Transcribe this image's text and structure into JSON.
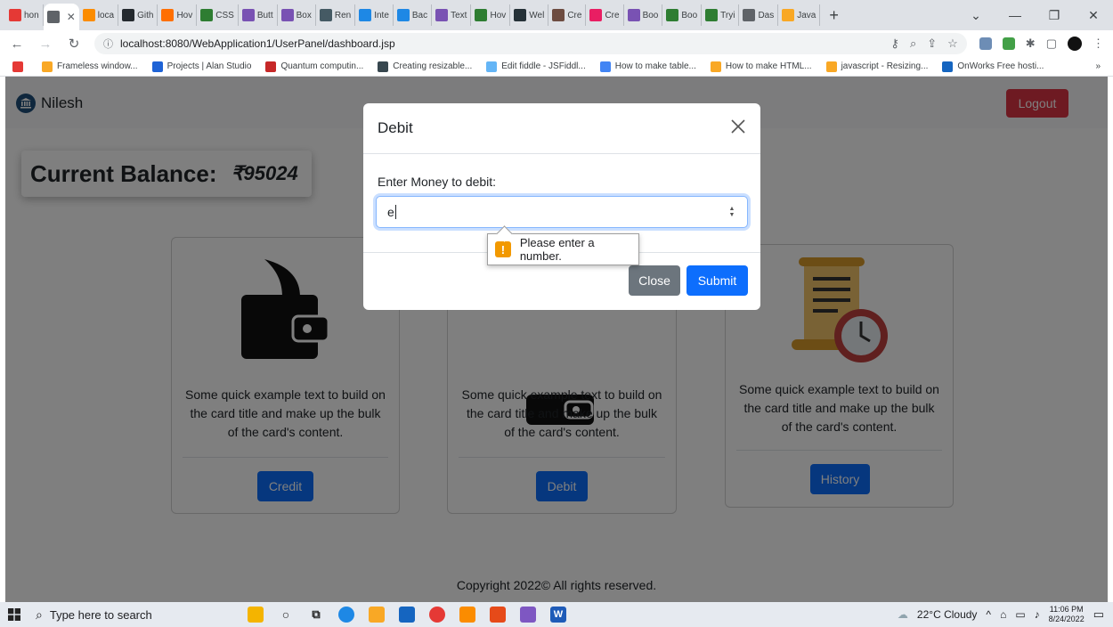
{
  "browser": {
    "tabs": [
      {
        "label": "hon",
        "icon": "youtube-icon",
        "color": "#e53935"
      },
      {
        "label": "",
        "icon": "globe-icon",
        "color": "#5f6368",
        "active": true
      },
      {
        "label": "loca",
        "icon": "xampp-icon",
        "color": "#fb8c00"
      },
      {
        "label": "Gith",
        "icon": "github-icon",
        "color": "#24292e"
      },
      {
        "label": "Hov",
        "icon": "blogger-icon",
        "color": "#ff6f00"
      },
      {
        "label": "CSS",
        "icon": "w-icon",
        "color": "#2e7d32"
      },
      {
        "label": "Butt",
        "icon": "bootstrap-icon",
        "color": "#7952b3"
      },
      {
        "label": "Box",
        "icon": "bootstrap-icon",
        "color": "#7952b3"
      },
      {
        "label": "Ren",
        "icon": "eye-icon",
        "color": "#455a64"
      },
      {
        "label": "Inte",
        "icon": "is-icon",
        "color": "#1e88e5"
      },
      {
        "label": "Bac",
        "icon": "is-icon",
        "color": "#1e88e5"
      },
      {
        "label": "Text",
        "icon": "bootstrap-icon",
        "color": "#7952b3"
      },
      {
        "label": "Hov",
        "icon": "w-icon",
        "color": "#2e7d32"
      },
      {
        "label": "Wel",
        "icon": "fiddle-icon",
        "color": "#263238"
      },
      {
        "label": "Cre",
        "icon": "image-icon",
        "color": "#6d4c41"
      },
      {
        "label": "Cre",
        "icon": "circle-icon",
        "color": "#e91e63"
      },
      {
        "label": "Boo",
        "icon": "bootstrap-icon",
        "color": "#7952b3"
      },
      {
        "label": "Boo",
        "icon": "w-icon",
        "color": "#2e7d32"
      },
      {
        "label": "Tryi",
        "icon": "w-icon",
        "color": "#2e7d32"
      },
      {
        "label": "Das",
        "icon": "globe-icon",
        "color": "#5f6368"
      },
      {
        "label": "Java",
        "icon": "java-icon",
        "color": "#f9a825"
      }
    ],
    "address": "localhost:8080/WebApplication1/UserPanel/dashboard.jsp",
    "bookmarks": [
      {
        "label": "",
        "color": "#e53935"
      },
      {
        "label": "Frameless window...",
        "color": "#f9a825"
      },
      {
        "label": "Projects | Alan Studio",
        "color": "#1e63d6"
      },
      {
        "label": "Quantum computin...",
        "color": "#c62828"
      },
      {
        "label": "Creating resizable...",
        "color": "#37474f"
      },
      {
        "label": "Edit fiddle - JSFiddl...",
        "color": "#64b5f6"
      },
      {
        "label": "How to make table...",
        "color": "#4285f4"
      },
      {
        "label": "How to make HTML...",
        "color": "#f9a825"
      },
      {
        "label": "javascript - Resizing...",
        "color": "#f9a825"
      },
      {
        "label": "OnWorks Free hosti...",
        "color": "#1565c0"
      }
    ]
  },
  "app": {
    "brand": "Nilesh",
    "logout": "Logout",
    "balance_label": "Current Balance:",
    "balance_amount": "₹95024",
    "cards": [
      {
        "text": "Some quick example text to build on the card title and make up the bulk of the card's content.",
        "button": "Credit",
        "icon": "wallet-credit-icon"
      },
      {
        "text": "Some quick example text to build on the card title and make up the bulk of the card's content.",
        "button": "Debit",
        "icon": "wallet-debit-icon"
      },
      {
        "text": "Some quick example text to build on the card title and make up the bulk of the card's content.",
        "button": "History",
        "icon": "history-scroll-icon"
      }
    ],
    "footer": "Copyright 2022© All rights reserved."
  },
  "modal": {
    "title": "Debit",
    "label": "Enter Money to debit:",
    "input_value": "e",
    "validation_message": "Please enter a number.",
    "close_button": "Close",
    "submit_button": "Submit"
  },
  "taskbar": {
    "search_placeholder": "Type here to search",
    "weather": "22°C  Cloudy",
    "time": "11:06 PM",
    "date": "8/24/2022"
  },
  "colors": {
    "primary": "#0d6efd",
    "danger": "#dc3545",
    "secondary": "#6c757d"
  }
}
